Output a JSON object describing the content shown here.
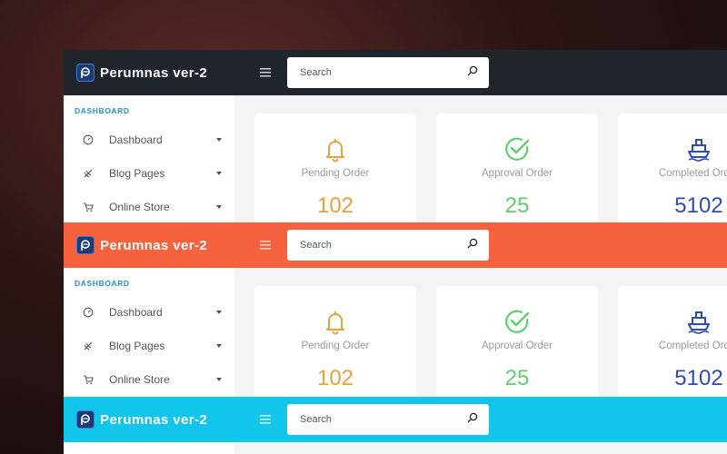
{
  "variants": [
    {
      "topbar_color": "#20242b",
      "brand": {
        "name": "Perumnas ver-2"
      },
      "search": {
        "placeholder": "Search"
      },
      "sidebar": {
        "heading": "DASHBOARD",
        "items": [
          {
            "label": "Dashboard",
            "icon": "dashboard-gauge-icon"
          },
          {
            "label": "Blog Pages",
            "icon": "blog-leaf-icon"
          },
          {
            "label": "Online Store",
            "icon": "shopping-cart-icon"
          }
        ]
      },
      "cards": [
        {
          "label": "Pending Order",
          "value": "102",
          "icon": "bell-icon",
          "color": "#e9a23b"
        },
        {
          "label": "Approval Order",
          "value": "25",
          "icon": "check-circle-icon",
          "color": "#5fcf6c"
        },
        {
          "label": "Completed Order",
          "value": "5102",
          "icon": "ship-icon",
          "color": "#2f4bb5"
        }
      ]
    },
    {
      "topbar_color": "#f6623e",
      "brand": {
        "name": "Perumnas ver-2"
      },
      "search": {
        "placeholder": "Search"
      },
      "sidebar": {
        "heading": "DASHBOARD",
        "items": [
          {
            "label": "Dashboard",
            "icon": "dashboard-gauge-icon"
          },
          {
            "label": "Blog Pages",
            "icon": "blog-leaf-icon"
          },
          {
            "label": "Online Store",
            "icon": "shopping-cart-icon"
          }
        ]
      },
      "cards": [
        {
          "label": "Pending Order",
          "value": "102",
          "icon": "bell-icon",
          "color": "#e9a23b"
        },
        {
          "label": "Approval Order",
          "value": "25",
          "icon": "check-circle-icon",
          "color": "#5fcf6c"
        },
        {
          "label": "Completed Order",
          "value": "5102",
          "icon": "ship-icon",
          "color": "#2f4bb5"
        }
      ]
    },
    {
      "topbar_color": "#12c5ea",
      "brand": {
        "name": "Perumnas ver-2"
      },
      "search": {
        "placeholder": "Search"
      }
    }
  ],
  "colors": {
    "sidebar_heading": "#2a8fc7",
    "content_bg": "#f3f3f3"
  }
}
